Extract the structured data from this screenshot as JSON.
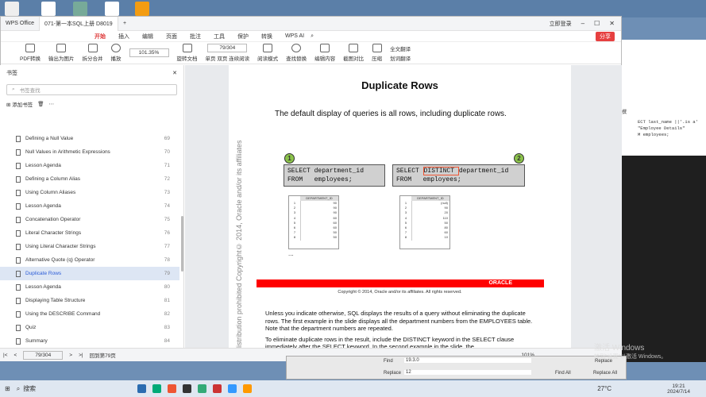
{
  "app": {
    "brand": "WPS Office",
    "doc_tab": "071-第一本SQL上册 D8019",
    "login": "立即登录"
  },
  "menu": {
    "items": [
      "开始",
      "插入",
      "编辑",
      "页面",
      "批注",
      "工具",
      "保护",
      "转换"
    ],
    "active": "开始",
    "ai": "WPS AI",
    "share": "分享"
  },
  "toolbar": {
    "items": [
      "PDF转换",
      "输出为图片",
      "拆分合并",
      "播放",
      "旋转文档",
      "单页",
      "双页",
      "连续阅读",
      "阅读模式",
      "查找替换",
      "编辑内容",
      "截图对比",
      "压缩",
      "划词翻译"
    ],
    "zoom": "101.35%",
    "page": "79/304",
    "translate": "全文翻译"
  },
  "sidebar": {
    "title": "书签",
    "search_placeholder": "书签查找",
    "add_label": "添加书签",
    "items": [
      {
        "label": "Defining a Null Value",
        "page": "69"
      },
      {
        "label": "Null Values in Arithmetic Expressions",
        "page": "70"
      },
      {
        "label": "Lesson Agenda",
        "page": "71"
      },
      {
        "label": "Defining a Column Alias",
        "page": "72"
      },
      {
        "label": "Using Column Aliases",
        "page": "73"
      },
      {
        "label": "Lesson Agenda",
        "page": "74"
      },
      {
        "label": "Concatenation Operator",
        "page": "75"
      },
      {
        "label": "Literal Character Strings",
        "page": "76"
      },
      {
        "label": "Using Literal Character Strings",
        "page": "77"
      },
      {
        "label": "Alternative Quote (q) Operator",
        "page": "78"
      },
      {
        "label": "Duplicate Rows",
        "page": "79",
        "selected": true
      },
      {
        "label": "Lesson Agenda",
        "page": "80"
      },
      {
        "label": "Displaying Table Structure",
        "page": "81"
      },
      {
        "label": "Using the DESCRIBE Command",
        "page": "82"
      },
      {
        "label": "Quiz",
        "page": "83"
      },
      {
        "label": "Summary",
        "page": "84"
      }
    ]
  },
  "slide": {
    "title": "Duplicate Rows",
    "subtitle": "The default display of queries is all rows, including duplicate rows.",
    "code1_line1": "SELECT department_id",
    "code1_line2": "FROM   employees;",
    "code2_pre": "SELECT ",
    "code2_kw": "DISTINCT ",
    "code2_post": "department_id",
    "code2_line2": "FROM   employees;",
    "badge1": "1",
    "badge2": "2",
    "col_header": "DEPARTMENT_ID",
    "table1": [
      [
        "1",
        "90"
      ],
      [
        "2",
        "90"
      ],
      [
        "3",
        "90"
      ],
      [
        "4",
        "60"
      ],
      [
        "5",
        "60"
      ],
      [
        "6",
        "60"
      ],
      [
        "7",
        "50"
      ],
      [
        "8",
        "50"
      ]
    ],
    "table2": [
      [
        "1",
        "(null)"
      ],
      [
        "2",
        "90"
      ],
      [
        "3",
        "20"
      ],
      [
        "4",
        "110"
      ],
      [
        "5",
        "50"
      ],
      [
        "6",
        "80"
      ],
      [
        "7",
        "60"
      ],
      [
        "8",
        "10"
      ]
    ],
    "ellipsis": "...",
    "oracle": "ORACLE",
    "copyright": "Copyright © 2014, Oracle and/or its affiliates. All rights reserved.",
    "vertical": "distribution prohibited  Copyright© 2014, Oracle and/or its affiliates"
  },
  "body": {
    "p1": "Unless you indicate otherwise, SQL displays the results of a query without eliminating the duplicate rows. The first example in the slide displays all the department numbers from the EMPLOYEES table. Note that the department numbers are repeated.",
    "p2": "To eliminate duplicate rows in the result, include the DISTINCT keyword in the SELECT clause immediately after the SELECT keyword. In the second example in the slide, the"
  },
  "status": {
    "page": "79/304",
    "text": "回到第79页",
    "zoom": "101%"
  },
  "right_window": {
    "code": "ECT last_name ||'.is a'\n\"Employee Details\"\nM employees;",
    "label": "撰"
  },
  "find": {
    "find_label": "Find",
    "find_value": "19.3.0",
    "replace_label": "Replace",
    "replace_value": "12",
    "find_all": "Find All",
    "replace_btn": "Replace",
    "replace_all": "Replace All"
  },
  "taskbar": {
    "search": "搜索",
    "weather": "27°C",
    "time": "19:21",
    "date": "2024/7/14"
  },
  "watermark": {
    "line1": "激活 Windows",
    "line2": "转到\"设置\"以激活 Windows。"
  },
  "colors": {
    "accent": "#d33333",
    "selected": "#2a5bd7",
    "oracle_red": "#ff0000",
    "badge_green": "#8bc34a"
  }
}
